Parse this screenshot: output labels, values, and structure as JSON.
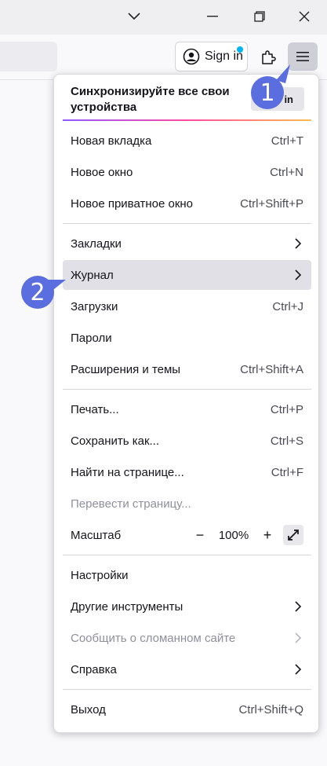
{
  "window": {
    "controls": [
      "chevron-down",
      "minimize",
      "restore",
      "close"
    ]
  },
  "toolbar": {
    "signin_label": "Sign in",
    "accent_dot_color": "#00b3f4"
  },
  "menu": {
    "sync": {
      "title": "Синхронизируйте все свои устройства",
      "button_fragment": "in"
    },
    "new_tab": {
      "label": "Новая вкладка",
      "shortcut": "Ctrl+T"
    },
    "new_window": {
      "label": "Новое окно",
      "shortcut": "Ctrl+N"
    },
    "new_private": {
      "label": "Новое приватное окно",
      "shortcut": "Ctrl+Shift+P"
    },
    "bookmarks": {
      "label": "Закладки"
    },
    "history": {
      "label": "Журнал"
    },
    "downloads": {
      "label": "Загрузки",
      "shortcut": "Ctrl+J"
    },
    "passwords": {
      "label": "Пароли"
    },
    "addons": {
      "label": "Расширения и темы",
      "shortcut": "Ctrl+Shift+A"
    },
    "print": {
      "label": "Печать...",
      "shortcut": "Ctrl+P"
    },
    "save_as": {
      "label": "Сохранить как...",
      "shortcut": "Ctrl+S"
    },
    "find": {
      "label": "Найти на странице...",
      "shortcut": "Ctrl+F"
    },
    "translate": {
      "label": "Перевести страницу..."
    },
    "zoom": {
      "label": "Масштаб",
      "minus": "−",
      "value": "100%",
      "plus": "+"
    },
    "settings": {
      "label": "Настройки"
    },
    "more_tools": {
      "label": "Другие инструменты"
    },
    "report": {
      "label": "Сообщить о сломанном сайте"
    },
    "help": {
      "label": "Справка"
    },
    "quit": {
      "label": "Выход",
      "shortcut": "Ctrl+Shift+Q"
    }
  },
  "annotations": {
    "badge1": "1",
    "badge2": "2",
    "color": "#5b6ee0"
  }
}
